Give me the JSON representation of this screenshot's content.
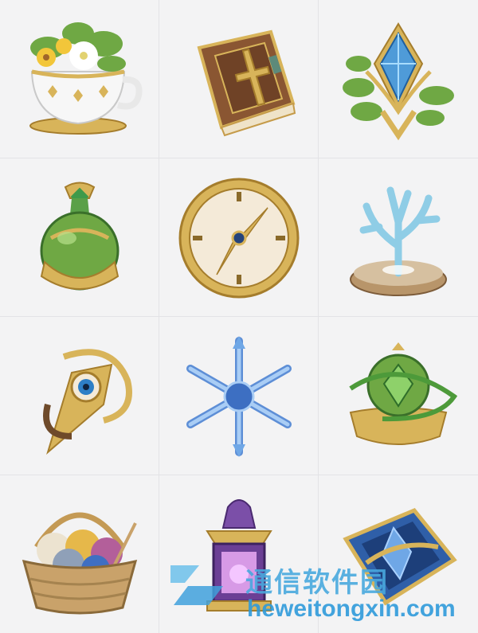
{
  "icons": [
    {
      "name": "teacup-flowers-icon"
    },
    {
      "name": "leather-book-icon"
    },
    {
      "name": "crystal-leaf-emblem-icon"
    },
    {
      "name": "green-orb-vial-icon"
    },
    {
      "name": "golden-clock-icon"
    },
    {
      "name": "blue-coral-icon"
    },
    {
      "name": "eye-sun-emblem-icon"
    },
    {
      "name": "snowflake-icon"
    },
    {
      "name": "green-gem-bowl-icon"
    },
    {
      "name": "yarn-basket-icon"
    },
    {
      "name": "purple-lantern-icon"
    },
    {
      "name": "blue-crystal-box-icon"
    }
  ],
  "watermark": {
    "site_name": "通信软件园",
    "url": "heweitongxin.com"
  },
  "colors": {
    "gold": "#d8b45a",
    "gold_dark": "#a57d2c",
    "leaf": "#6fa844",
    "crystal": "#6fa7e6",
    "purple": "#7b4fa8"
  }
}
